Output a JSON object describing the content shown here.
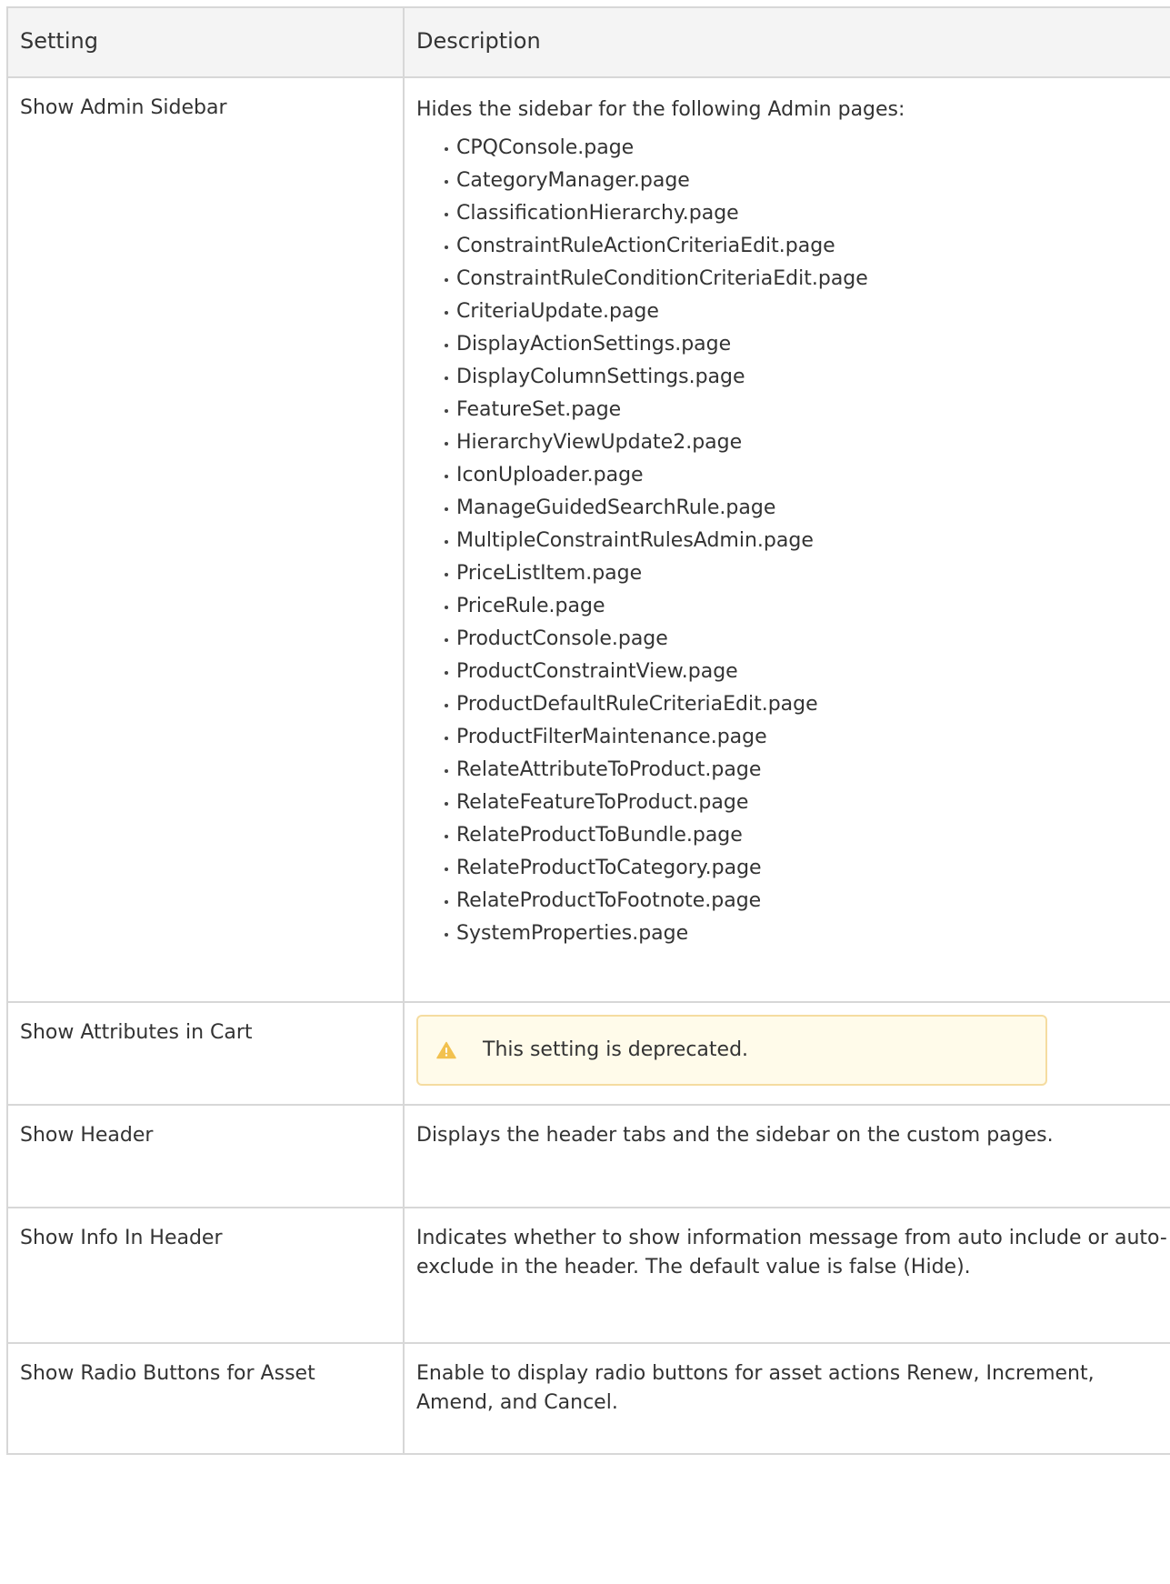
{
  "table": {
    "headers": {
      "setting": "Setting",
      "description": "Description"
    },
    "rows": [
      {
        "setting": "Show Admin Sidebar",
        "description": "Hides the sidebar for the following Admin pages:",
        "pages": [
          "CPQConsole.page",
          "CategoryManager.page",
          "ClassificationHierarchy.page",
          "ConstraintRuleActionCriteriaEdit.page",
          "ConstraintRuleConditionCriteriaEdit.page",
          "CriteriaUpdate.page",
          "DisplayActionSettings.page",
          "DisplayColumnSettings.page",
          "FeatureSet.page",
          "HierarchyViewUpdate2.page",
          "IconUploader.page",
          "ManageGuidedSearchRule.page",
          "MultipleConstraintRulesAdmin.page",
          "PriceListItem.page",
          "PriceRule.page",
          "ProductConsole.page",
          "ProductConstraintView.page",
          "ProductDefaultRuleCriteriaEdit.page",
          "ProductFilterMaintenance.page",
          "RelateAttributeToProduct.page",
          "RelateFeatureToProduct.page",
          "RelateProductToBundle.page",
          "RelateProductToCategory.page",
          "RelateProductToFootnote.page",
          "SystemProperties.page"
        ]
      },
      {
        "setting": "Show Attributes in Cart",
        "warning": "This setting is deprecated."
      },
      {
        "setting": "Show Header",
        "description": "Displays the header tabs and the sidebar on the custom pages."
      },
      {
        "setting": "Show Info In Header",
        "description": "Indicates whether to show information message from auto include or auto-exclude in the header. The default value is false (Hide)."
      },
      {
        "setting": "Show Radio Buttons for Asset",
        "description": "Enable to display radio buttons for asset actions Renew, Increment, Amend, and Cancel."
      }
    ]
  },
  "icons": {
    "warning": "warning-triangle-icon"
  },
  "colors": {
    "warning_icon": "#f2c14e",
    "warning_border": "#f5dca0",
    "warning_bg": "#fffbea",
    "header_bg": "#f4f4f4",
    "border": "#d7d7d7"
  }
}
